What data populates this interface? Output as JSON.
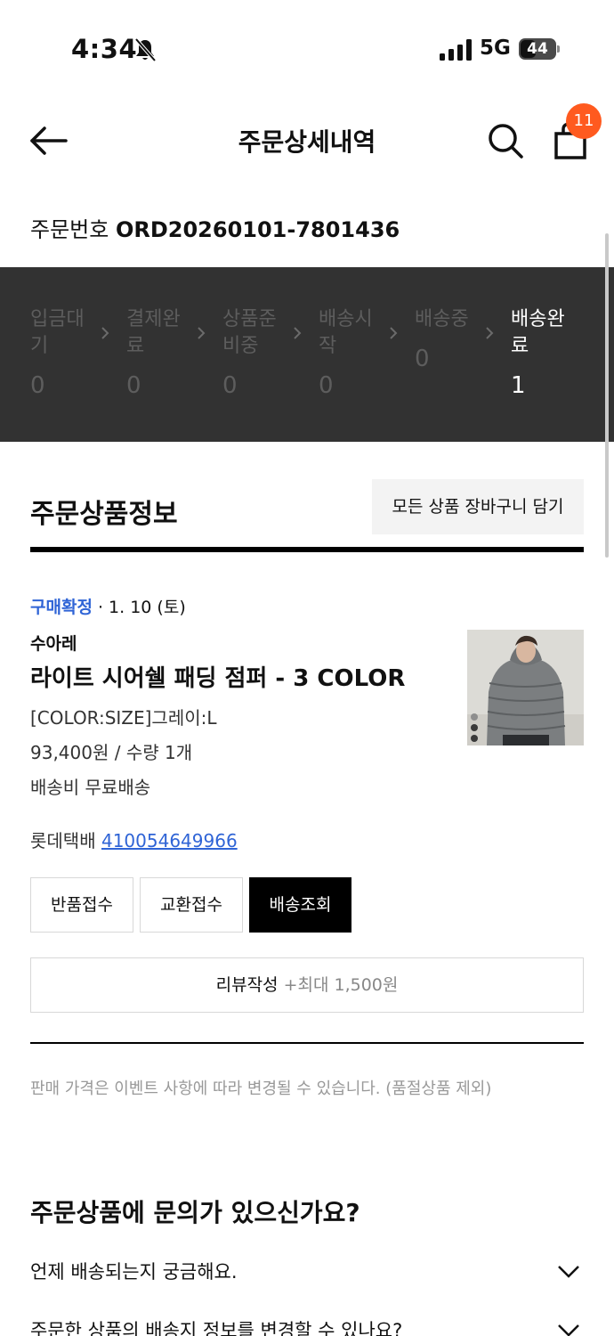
{
  "status_bar": {
    "time": "4:34",
    "network": "5G",
    "battery": "44",
    "battery_level": 0.44
  },
  "header": {
    "title": "주문상세내역",
    "cart_count": "11"
  },
  "order": {
    "number_label": "주문번호",
    "number": "ORD20260101-7801436"
  },
  "progress_steps": [
    {
      "label": "입금대기",
      "count": "0"
    },
    {
      "label": "결제완료",
      "count": "0"
    },
    {
      "label": "상품준비중",
      "count": "0"
    },
    {
      "label": "배송시작",
      "count": "0"
    },
    {
      "label": "배송중",
      "count": "0"
    },
    {
      "label": "배송완료",
      "count": "1"
    }
  ],
  "section": {
    "title": "주문상품정보",
    "add_all_to_cart": "모든 상품 장바구니 담기"
  },
  "product": {
    "purchase_status": "구매확정",
    "date": "· 1. 10 (토)",
    "brand": "수아레",
    "name": "라이트 시어쉘 패딩 점퍼 - 3 COLOR",
    "option": "[COLOR:SIZE]그레이:L",
    "price_qty": "93,400원 / 수량 1개",
    "shipping_fee": "배송비 무료배송",
    "courier": "롯데택배",
    "tracking_number": "410054649966"
  },
  "actions": {
    "return": "반품접수",
    "exchange": "교환접수",
    "tracking": "배송조회"
  },
  "review": {
    "label": "리뷰작성",
    "reward": "+최대 1,500원"
  },
  "notice": "판매 가격은 이벤트 사항에 따라 변경될 수 있습니다. (품절상품 제외)",
  "faq": {
    "title": "주문상품에 문의가 있으신가요?",
    "items": [
      "언제 배송되는지 궁금해요.",
      "주문한 상품의 배송지 정보를 변경할 수 있나요?"
    ]
  },
  "icons": {
    "back": "arrow-left-icon",
    "search": "search-icon",
    "bag": "shopping-bag-icon",
    "bell_off": "bell-off-icon",
    "chevron": "chevron-right-icon",
    "expand": "chevron-down-icon"
  },
  "colors": {
    "accent_link": "#2f64d6",
    "badge": "#ff5a1f",
    "progress_bg": "#323232"
  }
}
